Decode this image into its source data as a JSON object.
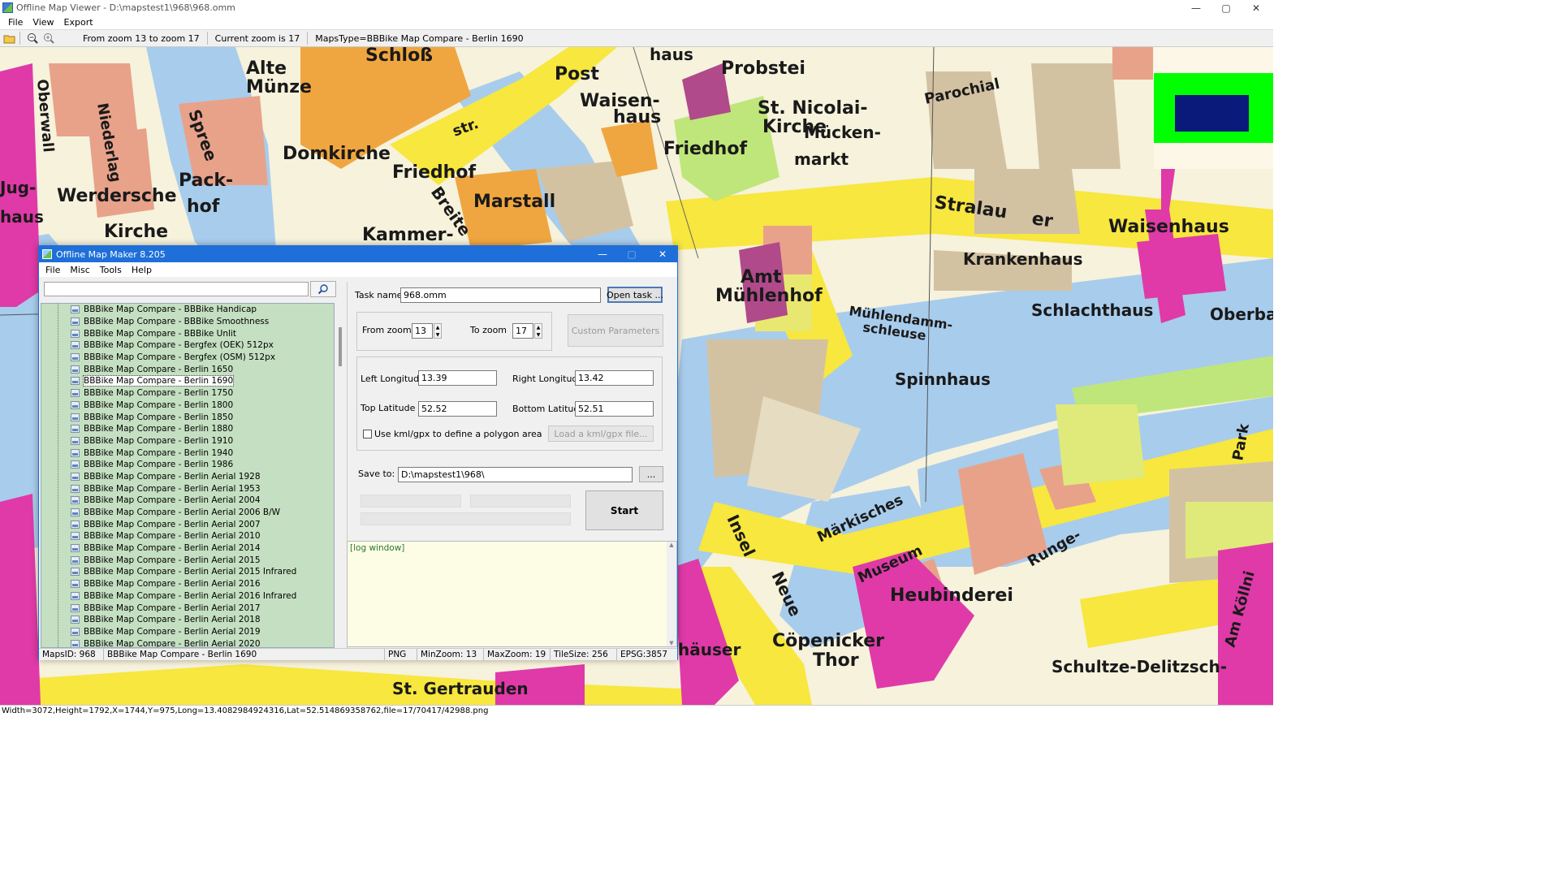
{
  "window": {
    "title": "Offline Map Viewer - D:\\mapstest1\\968\\968.omm",
    "controls": {
      "minimize": "—",
      "maximize": "▢",
      "close": "✕"
    }
  },
  "menu": [
    "File",
    "View",
    "Export"
  ],
  "toolbar": {
    "zoom_range": "From zoom 13 to zoom 17",
    "current_zoom": "Current zoom is 17",
    "maps_type": "MapsType=BBBike Map Compare - Berlin 1690"
  },
  "map": {
    "labels": [
      "Schloß",
      "Alte",
      "Münze",
      "Post",
      "Waisen-",
      "haus",
      "Probstei",
      "St. Nicolai-",
      "Kirche",
      "Domkirche",
      "Friedhof",
      "Friedhof",
      "Marstall",
      "Werdersche",
      "Kirche",
      "Pack-",
      "hof",
      "Kammer-",
      "Stralau",
      "er",
      "Waisenhaus",
      "Krankenhaus",
      "Amt",
      "Mühlenhof",
      "Schlachthaus",
      "Oberba",
      "Spinnhaus",
      "Heubinderei",
      "Cöpenicker",
      "Thor",
      "Schultze-Delitzsch-",
      "St. Gertrauden",
      "häuser",
      "Mühlendamm-",
      "schleuse",
      "markt",
      "Mücken-",
      "Breite",
      "str.",
      "Parochial",
      "Spree",
      "Niederlag",
      "Oberwall",
      "Insel",
      "Neue",
      "Märkisches",
      "Museum",
      "Runge-",
      "Am Köllni",
      "Park",
      "haus",
      "Jug-",
      "haus"
    ],
    "colors": {
      "water": "#a8ccec",
      "road": "#f7e73e",
      "building": "#e8a28a",
      "area": "#d3c2a2",
      "magenta": "#df3aa8",
      "orange": "#f0a640",
      "green": "#bfe67a"
    }
  },
  "status_bar": "Width=3072,Height=1792,X=1744,Y=975,Long=13.4082984924316,Lat=52.514869358762,file=17/70417/42988.png",
  "dialog": {
    "title": "Offline Map Maker 8.205",
    "menu": [
      "File",
      "Misc",
      "Tools",
      "Help"
    ],
    "search_value": "",
    "search_icon": "magnifier-icon",
    "tree_items": [
      "BBBike Map Compare - BBBike Handicap",
      "BBBike Map Compare - BBBike Smoothness",
      "BBBike Map Compare - BBBike Unlit",
      "BBBike Map Compare - Bergfex (OEK) 512px",
      "BBBike Map Compare - Bergfex (OSM) 512px",
      "BBBike Map Compare - Berlin 1650",
      "BBBike Map Compare - Berlin 1690",
      "BBBike Map Compare - Berlin 1750",
      "BBBike Map Compare - Berlin 1800",
      "BBBike Map Compare - Berlin 1850",
      "BBBike Map Compare - Berlin 1880",
      "BBBike Map Compare - Berlin 1910",
      "BBBike Map Compare - Berlin 1940",
      "BBBike Map Compare - Berlin 1986",
      "BBBike Map Compare - Berlin Aerial 1928",
      "BBBike Map Compare - Berlin Aerial 1953",
      "BBBike Map Compare - Berlin Aerial 2004",
      "BBBike Map Compare - Berlin Aerial 2006 B/W",
      "BBBike Map Compare - Berlin Aerial 2007",
      "BBBike Map Compare - Berlin Aerial 2010",
      "BBBike Map Compare - Berlin Aerial 2014",
      "BBBike Map Compare - Berlin Aerial 2015",
      "BBBike Map Compare - Berlin Aerial 2015 Infrared",
      "BBBike Map Compare - Berlin Aerial 2016",
      "BBBike Map Compare - Berlin Aerial 2016 Infrared",
      "BBBike Map Compare - Berlin Aerial 2017",
      "BBBike Map Compare - Berlin Aerial 2018",
      "BBBike Map Compare - Berlin Aerial 2019",
      "BBBike Map Compare - Berlin Aerial 2020"
    ],
    "selected_item": "BBBike Map Compare - Berlin 1690",
    "task_name_label": "Task name",
    "task_name": "968.omm",
    "open_task": "Open task ...",
    "from_zoom_label": "From zoom",
    "from_zoom": "13",
    "to_zoom_label": "To zoom",
    "to_zoom": "17",
    "custom_parameters": "Custom Parameters",
    "left_longitude_label": "Left Longitude",
    "left_longitude": "13.39",
    "right_longitude_label": "Right Longitude",
    "right_longitude": "13.42",
    "top_latitude_label": "Top Latitude",
    "top_latitude": "52.52",
    "bottom_latitude_label": "Bottom Latitude",
    "bottom_latitude": "52.51",
    "kml_checkbox_label": "Use kml/gpx to define a polygon area",
    "kml_checked": false,
    "load_kml": "Load a kml/gpx file...",
    "save_to_label": "Save to:",
    "save_to": "D:\\mapstest1\\968\\",
    "browse": "...",
    "start": "Start",
    "log_text": "[log window]",
    "status": {
      "maps_id": "MapsID: 968",
      "map_name": "BBBike Map Compare - Berlin 1690",
      "format": "PNG",
      "min_zoom": "MinZoom: 13",
      "max_zoom": "MaxZoom: 19",
      "tile_size": "TileSize: 256",
      "epsg": "EPSG:3857"
    }
  }
}
